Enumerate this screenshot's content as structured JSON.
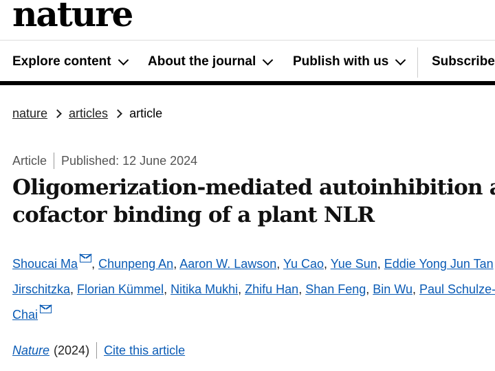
{
  "header": {
    "logo": "nature"
  },
  "nav": {
    "items": [
      {
        "label": "Explore content"
      },
      {
        "label": "About the journal"
      },
      {
        "label": "Publish with us"
      },
      {
        "label": "Subscribe"
      }
    ]
  },
  "breadcrumb": [
    "nature",
    "articles",
    "article"
  ],
  "meta": {
    "type": "Article",
    "published": "Published: 12 June 2024"
  },
  "title": {
    "line1": "Oligomerization-mediated autoinhibition and",
    "line2": "cofactor binding of a plant NLR"
  },
  "authors": [
    "Shoucai Ma",
    "Chunpeng An",
    "Aaron W. Lawson",
    "Yu Cao",
    "Yue Sun",
    "Eddie Yong Jun Tan",
    "Jirschitzka",
    "Florian Kümmel",
    "Nitika Mukhi",
    "Zhifu Han",
    "Shan Feng",
    "Bin Wu",
    "Paul Schulze-Lefert",
    "Chai"
  ],
  "citation": {
    "journal": "Nature",
    "year": "(2024)",
    "cite_label": "Cite this article"
  },
  "colors": {
    "link": "#0a5bb5",
    "nav_border": "#000000",
    "meta_text": "#555555"
  }
}
